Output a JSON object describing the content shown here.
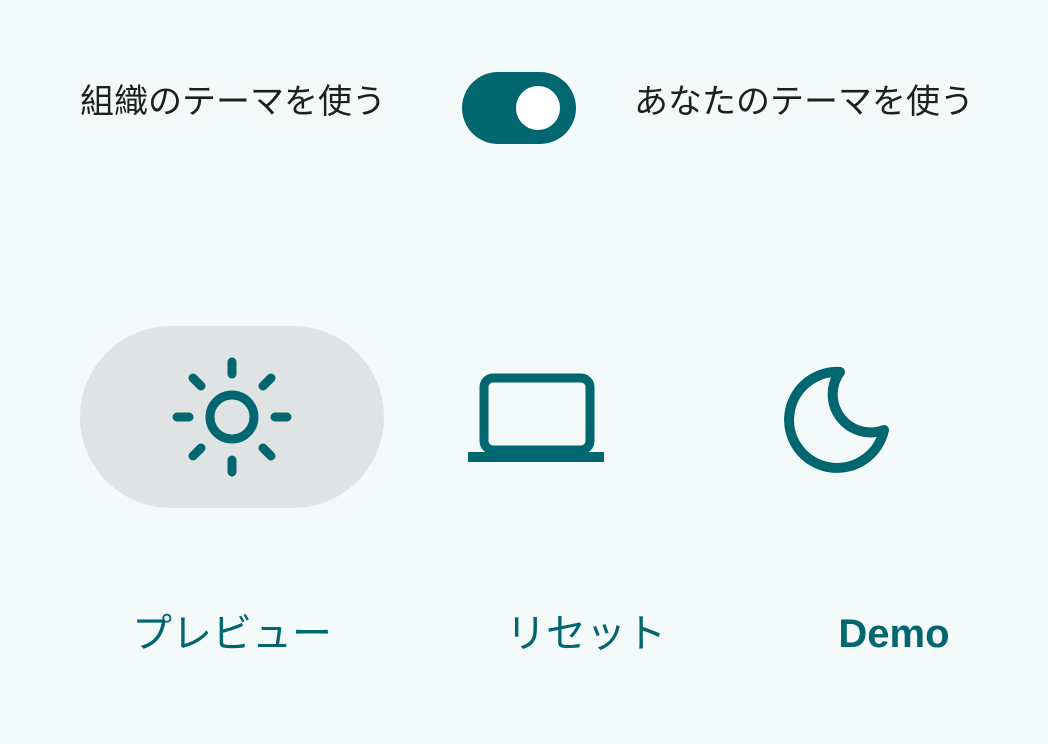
{
  "theme_toggle": {
    "left_label": "組織のテーマを使う",
    "right_label": "あなたのテーマを使う",
    "state": "on"
  },
  "modes": [
    {
      "icon": "sun-icon",
      "label": "プレビュー",
      "selected": true
    },
    {
      "icon": "laptop-icon",
      "label": "リセット",
      "selected": false
    },
    {
      "icon": "moon-icon",
      "label": "Demo",
      "selected": false
    }
  ],
  "colors": {
    "accent": "#00666f",
    "background": "#f4f9f9",
    "selected_pill": "#dfe3e4",
    "text": "#1f1f1f"
  }
}
